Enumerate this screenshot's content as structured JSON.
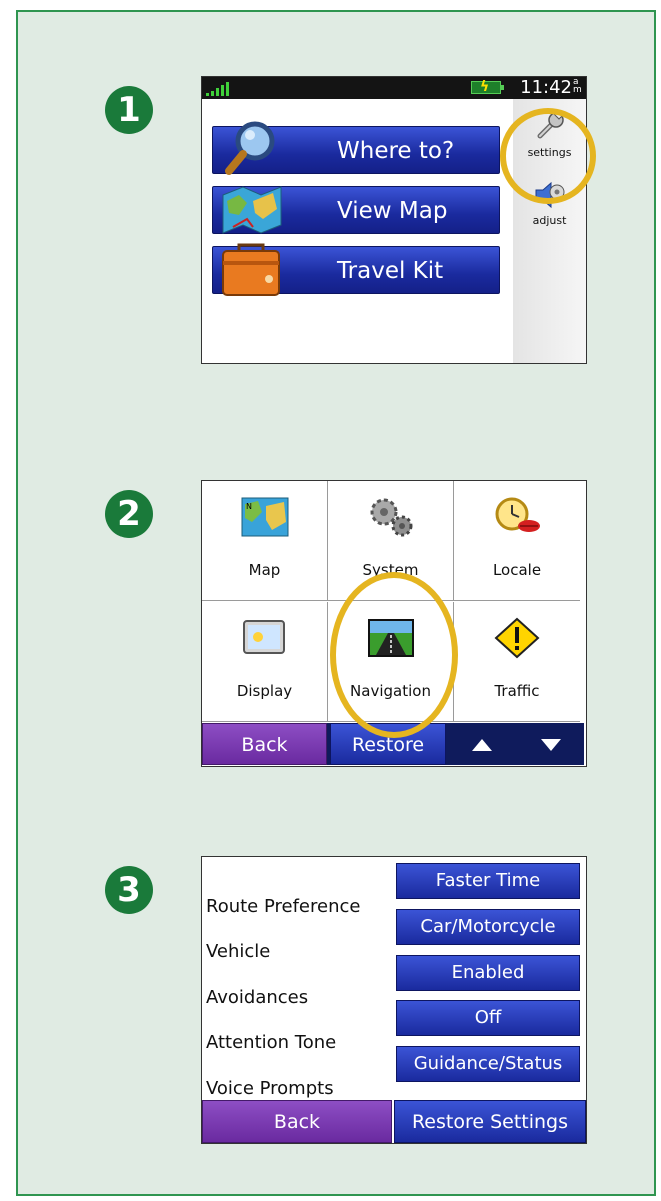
{
  "steps": [
    "1",
    "2",
    "3"
  ],
  "screen1": {
    "clock": "11:42",
    "clock_ampm": "a m",
    "main_buttons": [
      {
        "label": "Where to?",
        "icon": "magnifier-icon"
      },
      {
        "label": "View Map",
        "icon": "map-icon"
      },
      {
        "label": "Travel Kit",
        "icon": "suitcase-icon"
      }
    ],
    "side_buttons": [
      {
        "label": "settings",
        "icon": "wrench-icon"
      },
      {
        "label": "adjust",
        "icon": "speaker-icon"
      }
    ]
  },
  "screen2": {
    "tiles": [
      {
        "label": "Map",
        "icon": "map-icon"
      },
      {
        "label": "System",
        "icon": "gears-icon"
      },
      {
        "label": "Locale",
        "icon": "clock-icon"
      },
      {
        "label": "Display",
        "icon": "display-icon"
      },
      {
        "label": "Navigation",
        "icon": "road-icon"
      },
      {
        "label": "Traffic",
        "icon": "warning-icon"
      }
    ],
    "back": "Back",
    "restore": "Restore"
  },
  "screen3": {
    "rows": [
      {
        "label": "Route Preference",
        "value": "Faster Time"
      },
      {
        "label": "Vehicle",
        "value": "Car/Motorcycle"
      },
      {
        "label": "Avoidances",
        "value": "Enabled"
      },
      {
        "label": "Attention Tone",
        "value": "Off"
      },
      {
        "label": "Voice Prompts",
        "value": "Guidance/Status"
      }
    ],
    "back": "Back",
    "restore": "Restore Settings"
  },
  "colors": {
    "panel_bg": "#e0ebe3",
    "panel_border": "#2f9550",
    "step_badge": "#1a7a3a",
    "button_blue": "#1a2a9e",
    "button_purple": "#6a2aa0",
    "highlight_circle": "#e5b520"
  }
}
